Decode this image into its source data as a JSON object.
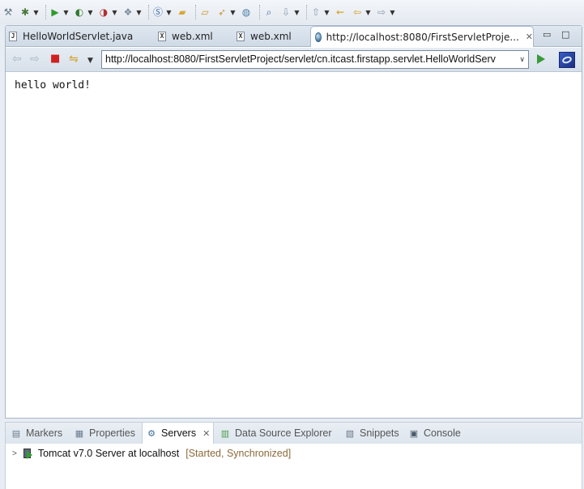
{
  "toolbar": {
    "groups": [
      {
        "name": "wrench-icon",
        "glyph": "⚒",
        "color": "#6a7a8c",
        "dropdown": false
      },
      {
        "name": "debug-icon",
        "glyph": "✱",
        "color": "#4a7a3a",
        "dropdown": true
      },
      {
        "name": "run-icon",
        "glyph": "▶",
        "color": "#2f9a2f",
        "dropdown": true
      },
      {
        "name": "run-config-icon",
        "glyph": "◐",
        "color": "#2f7a2f",
        "dropdown": true
      },
      {
        "name": "external-tools-icon",
        "glyph": "◑",
        "color": "#b03030",
        "dropdown": true
      },
      {
        "name": "new-server-icon",
        "glyph": "❖",
        "color": "#7a8a9a",
        "dropdown": true
      },
      {
        "name": "new-class-icon",
        "glyph": "Ⓢ",
        "color": "#3a6aa8",
        "dropdown": true
      },
      {
        "name": "open-folder-icon",
        "glyph": "▰",
        "color": "#d9a836",
        "dropdown": false
      },
      {
        "name": "open-project-icon",
        "glyph": "▱",
        "color": "#c8962a",
        "dropdown": false
      },
      {
        "name": "open-task-icon",
        "glyph": "➶",
        "color": "#c89b3a",
        "dropdown": true
      },
      {
        "name": "globe-icon",
        "glyph": "◍",
        "color": "#4d7fa8",
        "dropdown": false
      },
      {
        "name": "search-icon",
        "glyph": "⌕",
        "color": "#3a6a9a",
        "dropdown": false
      },
      {
        "name": "next-annotation-icon",
        "glyph": "⇩",
        "color": "#8a9aaa",
        "dropdown": true
      },
      {
        "name": "prev-annotation-icon",
        "glyph": "⇧",
        "color": "#8a9aaa",
        "dropdown": true
      },
      {
        "name": "last-edit-icon",
        "glyph": "⇜",
        "color": "#d4a020",
        "dropdown": false
      },
      {
        "name": "back-icon",
        "glyph": "⇦",
        "color": "#d4a020",
        "dropdown": true
      },
      {
        "name": "forward-icon",
        "glyph": "⇨",
        "color": "#8a9aaa",
        "dropdown": true
      }
    ]
  },
  "editor": {
    "tabs": [
      {
        "label": "HelloWorldServlet.java",
        "badge": "J"
      },
      {
        "label": "web.xml",
        "badge": "X"
      },
      {
        "label": "web.xml",
        "badge": "X"
      }
    ],
    "active_tab": {
      "label": "http://localhost:8080/FirstServletProje...",
      "close": "✕"
    },
    "minimize": "▭",
    "maximize": "□"
  },
  "browser": {
    "back": "⇦",
    "forward": "⇨",
    "stop": "■",
    "refresh": "⇋",
    "url": "http://localhost:8080/FirstServletProject/servlet/cn.itcast.firstapp.servlet.HelloWorldServ",
    "url_dropdown": "∨",
    "content": "hello world!"
  },
  "panel": {
    "tabs": [
      {
        "label": "Markers",
        "icon": "markers-icon",
        "glyph": "▤"
      },
      {
        "label": "Properties",
        "icon": "properties-icon",
        "glyph": "▦"
      },
      {
        "label": "Servers",
        "icon": "servers-icon",
        "glyph": "⚙",
        "active": true
      },
      {
        "label": "Data Source Explorer",
        "icon": "database-icon",
        "glyph": "▥"
      },
      {
        "label": "Snippets",
        "icon": "snippets-icon",
        "glyph": "▧"
      },
      {
        "label": "Console",
        "icon": "console-icon",
        "glyph": "▣"
      }
    ],
    "close": "✕",
    "server": {
      "name": "Tomcat v7.0 Server at localhost",
      "status": "[Started, Synchronized]"
    }
  },
  "colors": {
    "stop": "#d02020",
    "refresh": "#d4a020",
    "nav_disabled": "#a8b4c2"
  }
}
